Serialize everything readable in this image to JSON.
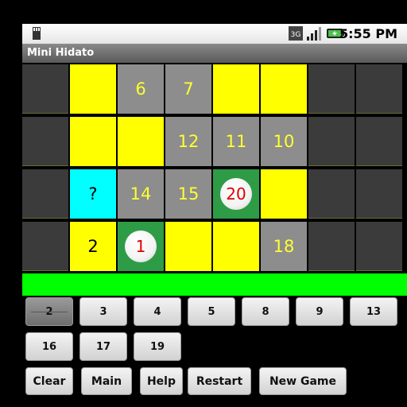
{
  "status": {
    "time": "5:55 PM",
    "network": "3G"
  },
  "app": {
    "title": "Mini Hidato"
  },
  "board": {
    "rows": [
      [
        {
          "type": "empty",
          "value": ""
        },
        {
          "type": "yellow",
          "value": ""
        },
        {
          "type": "gray",
          "value": "6"
        },
        {
          "type": "gray",
          "value": "7"
        },
        {
          "type": "yellow",
          "value": ""
        },
        {
          "type": "yellow",
          "value": ""
        },
        {
          "type": "empty",
          "value": ""
        },
        {
          "type": "empty",
          "value": ""
        }
      ],
      [
        {
          "type": "empty",
          "value": ""
        },
        {
          "type": "yellow",
          "value": ""
        },
        {
          "type": "yellow",
          "value": ""
        },
        {
          "type": "gray",
          "value": "12"
        },
        {
          "type": "gray",
          "value": "11"
        },
        {
          "type": "gray",
          "value": "10"
        },
        {
          "type": "empty",
          "value": ""
        },
        {
          "type": "empty",
          "value": ""
        }
      ],
      [
        {
          "type": "empty",
          "value": ""
        },
        {
          "type": "cyan",
          "value": "?"
        },
        {
          "type": "gray",
          "value": "14"
        },
        {
          "type": "gray",
          "value": "15"
        },
        {
          "type": "green",
          "value": "20"
        },
        {
          "type": "yellow",
          "value": ""
        },
        {
          "type": "empty",
          "value": ""
        },
        {
          "type": "empty",
          "value": ""
        }
      ],
      [
        {
          "type": "empty",
          "value": ""
        },
        {
          "type": "yellow",
          "value": "2"
        },
        {
          "type": "green",
          "value": "1"
        },
        {
          "type": "yellow",
          "value": ""
        },
        {
          "type": "yellow",
          "value": ""
        },
        {
          "type": "gray",
          "value": "18"
        },
        {
          "type": "empty",
          "value": ""
        },
        {
          "type": "empty",
          "value": ""
        }
      ]
    ]
  },
  "progress": {
    "fraction": 1.0
  },
  "number_buttons": [
    "2",
    "3",
    "4",
    "5",
    "8",
    "9",
    "13",
    "16",
    "17",
    "19"
  ],
  "selected_number": "2",
  "commands": {
    "clear": "Clear",
    "main": "Main",
    "help": "Help",
    "restart": "Restart",
    "new_game": "New Game"
  },
  "colors": {
    "yellow": "#ffff00",
    "gray": "#8d8d8d",
    "cyan": "#00ffff",
    "green": "#2e9c46",
    "progress": "#00ff00",
    "number_text": "#ffff33",
    "endpoint_text": "#e00000"
  }
}
